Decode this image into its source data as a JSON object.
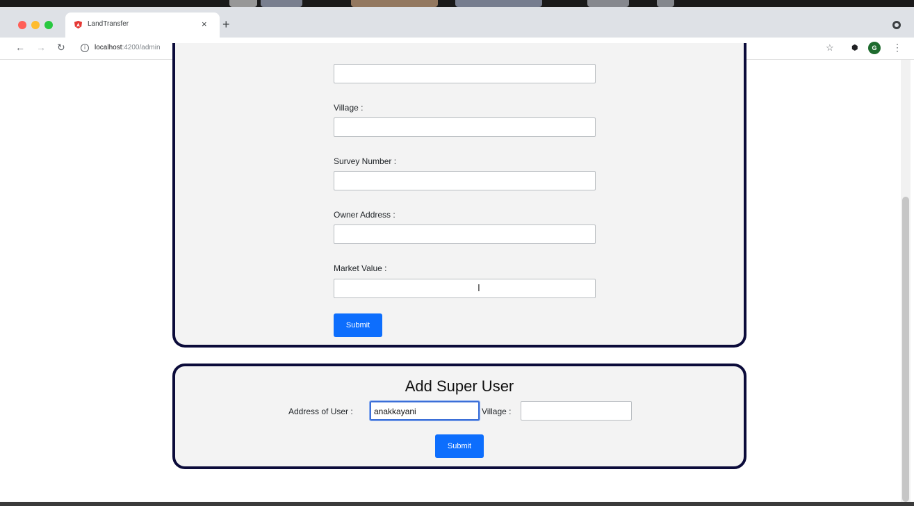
{
  "browser": {
    "tab_title": "LandTransfer",
    "tab_close": "×",
    "new_tab": "+",
    "url_host": "localhost",
    "url_path": ":4200/admin",
    "nav_back": "←",
    "nav_forward": "→",
    "nav_reload": "↻",
    "info_glyph": "i",
    "star_glyph": "☆",
    "extensions_glyph": "⬢",
    "avatar_initial": "G",
    "menu_glyph": "⋮",
    "colors": {
      "close": "#ff5f57",
      "minimize": "#febc2e",
      "maximize": "#28c840",
      "favicon": "#e53935"
    }
  },
  "land_form": {
    "fields": [
      {
        "label": "",
        "value": ""
      },
      {
        "label": "Village :",
        "value": ""
      },
      {
        "label": "Survey Number :",
        "value": ""
      },
      {
        "label": "Owner Address :",
        "value": ""
      },
      {
        "label": "Market Value :",
        "value": ""
      }
    ],
    "submit_label": "Submit"
  },
  "super_user": {
    "heading": "Add Super User",
    "address_label": "Address of User :",
    "address_value": "anakkayani",
    "village_label": "Village :",
    "village_value": "",
    "submit_label": "Submit"
  },
  "theme": {
    "accent": "#0d6efd",
    "card_border": "#0b0b3a",
    "card_bg": "#f3f3f3"
  }
}
